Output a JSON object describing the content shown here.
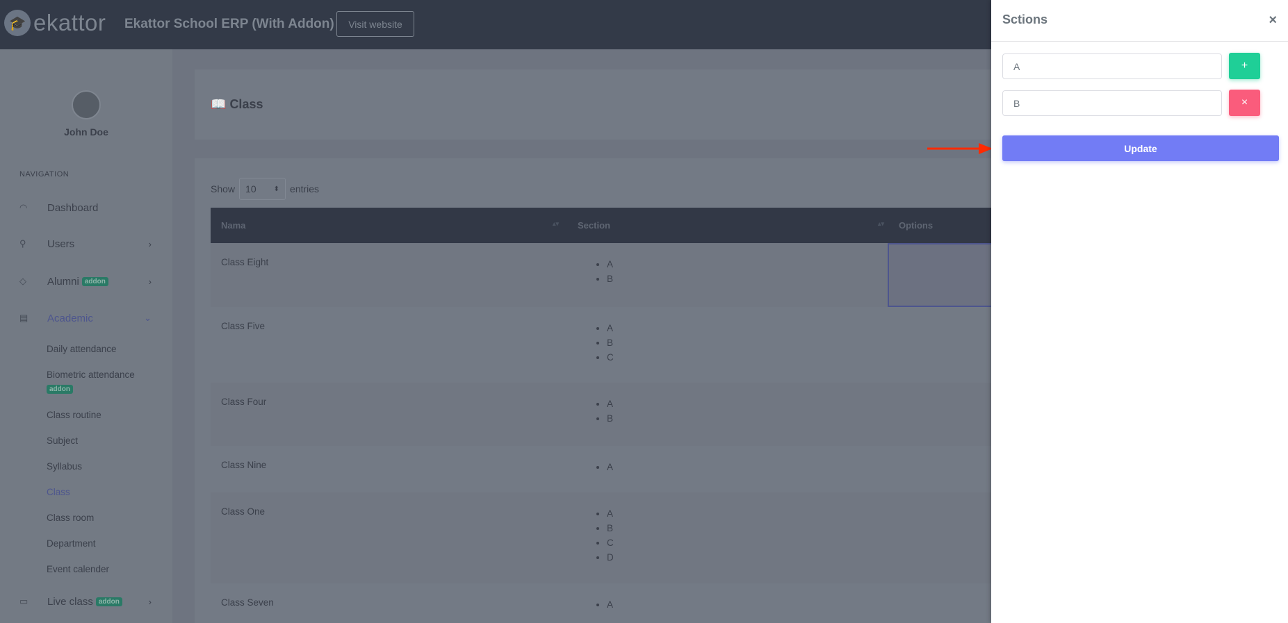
{
  "header": {
    "logo_text": "ekattor",
    "app_title": "Ekattor School ERP (With Addon)",
    "visit_label": "Visit website"
  },
  "sidebar": {
    "user_name": "John Doe",
    "nav_label": "NAVIGATION",
    "badge": "addon",
    "items": [
      {
        "label": "Dashboard",
        "icon": "gauge-icon"
      },
      {
        "label": "Users",
        "icon": "user-icon"
      },
      {
        "label": "Alumni",
        "icon": "graduation-cap-icon"
      },
      {
        "label": "Academic",
        "icon": "school-icon"
      },
      {
        "label": "Live class",
        "icon": "video-icon"
      }
    ],
    "academic_sub": [
      "Daily attendance",
      "Biometric attendance",
      "Class routine",
      "Subject",
      "Syllabus",
      "Class",
      "Class room",
      "Department",
      "Event calender"
    ]
  },
  "main": {
    "title": "Class",
    "show_label": "Show",
    "entries_value": "10",
    "entries_label": "entries",
    "columns": [
      "Nama",
      "Section",
      "Options"
    ],
    "rows": [
      {
        "name": "Class Eight",
        "sections": [
          "A",
          "B"
        ]
      },
      {
        "name": "Class Five",
        "sections": [
          "A",
          "B",
          "C"
        ]
      },
      {
        "name": "Class Four",
        "sections": [
          "A",
          "B"
        ]
      },
      {
        "name": "Class Nine",
        "sections": [
          "A"
        ]
      },
      {
        "name": "Class One",
        "sections": [
          "A",
          "B",
          "C",
          "D"
        ]
      },
      {
        "name": "Class Seven",
        "sections": [
          "A"
        ]
      }
    ]
  },
  "panel": {
    "title": "Sctions",
    "close": "×",
    "sections": [
      "A",
      "B"
    ],
    "add": "+",
    "remove": "×",
    "update_label": "Update",
    "colors": {
      "add": "#1fcf97",
      "remove": "#fa5c7c",
      "update": "#727cf5",
      "arrow": "#ff2a00"
    }
  }
}
